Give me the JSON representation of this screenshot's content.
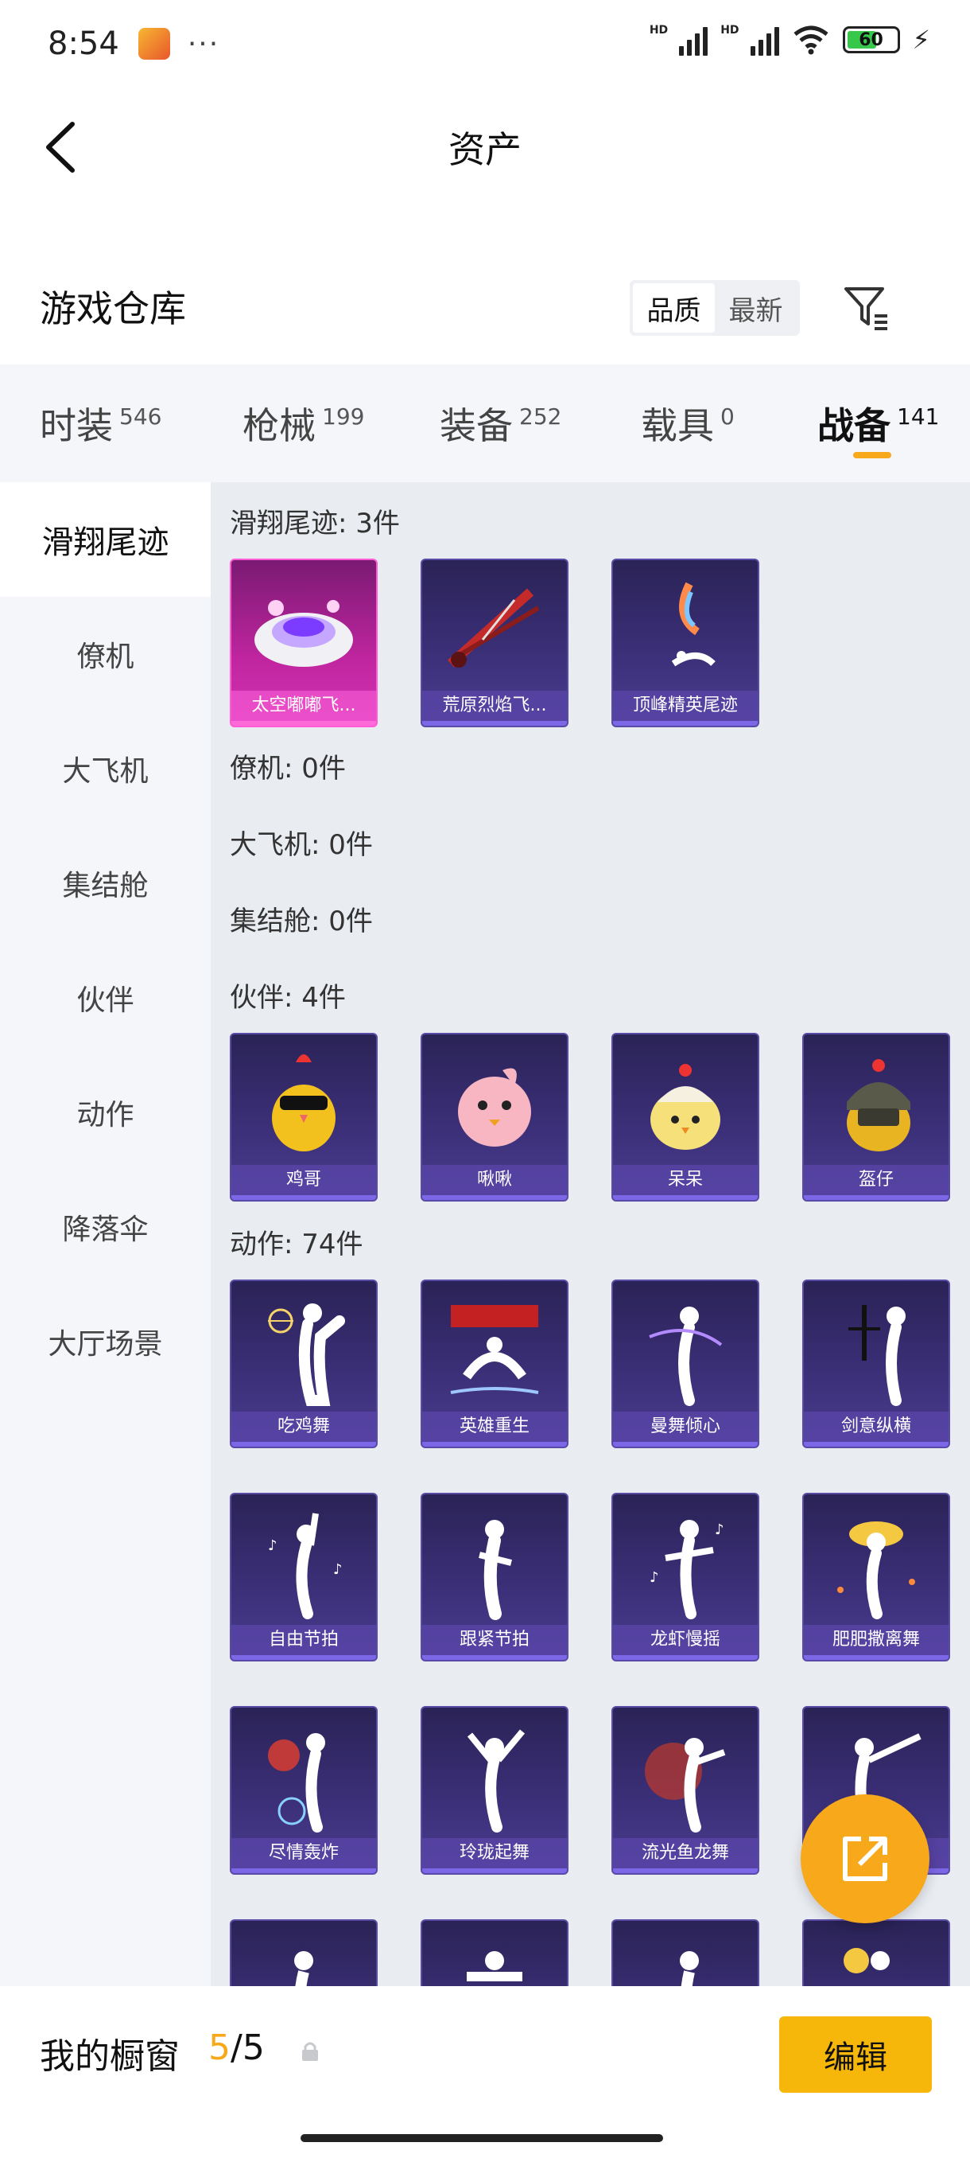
{
  "status_bar": {
    "time": "8:54",
    "more": "···",
    "battery": "60",
    "signal_label": "HD"
  },
  "header": {
    "title": "资产"
  },
  "section": {
    "title": "游戏仓库",
    "sort_options": [
      "品质",
      "最新"
    ],
    "sort_active": "品质"
  },
  "tabs": [
    {
      "label": "时装",
      "count": "546"
    },
    {
      "label": "枪械",
      "count": "199"
    },
    {
      "label": "装备",
      "count": "252"
    },
    {
      "label": "载具",
      "count": "0"
    },
    {
      "label": "战备",
      "count": "141"
    }
  ],
  "active_tab": "战备",
  "sidebar": {
    "items": [
      "滑翔尾迹",
      "僚机",
      "大飞机",
      "集结舱",
      "伙伴",
      "动作",
      "降落伞",
      "大厅场景"
    ],
    "active": "滑翔尾迹"
  },
  "categories": {
    "glide": {
      "label": "滑翔尾迹: 3件",
      "items": [
        "太空嘟嘟飞...",
        "荒原烈焰飞...",
        "顶峰精英尾迹"
      ]
    },
    "wingman": {
      "label": "僚机: 0件"
    },
    "plane": {
      "label": "大飞机: 0件"
    },
    "pod": {
      "label": "集结舱: 0件"
    },
    "partner": {
      "label": "伙伴: 4件",
      "items": [
        "鸡哥",
        "啾啾",
        "呆呆",
        "盔仔"
      ]
    },
    "emote": {
      "label": "动作: 74件",
      "items": [
        "吃鸡舞",
        "英雄重生",
        "曼舞倾心",
        "剑意纵横",
        "自由节拍",
        "跟紧节拍",
        "龙虾慢摇",
        "肥肥撒离舞",
        "尽情轰炸",
        "玲珑起舞",
        "流光鱼龙舞",
        ""
      ]
    }
  },
  "bottom": {
    "title": "我的橱窗",
    "current": "5",
    "separator": "/",
    "total": "5",
    "edit_label": "编辑"
  }
}
